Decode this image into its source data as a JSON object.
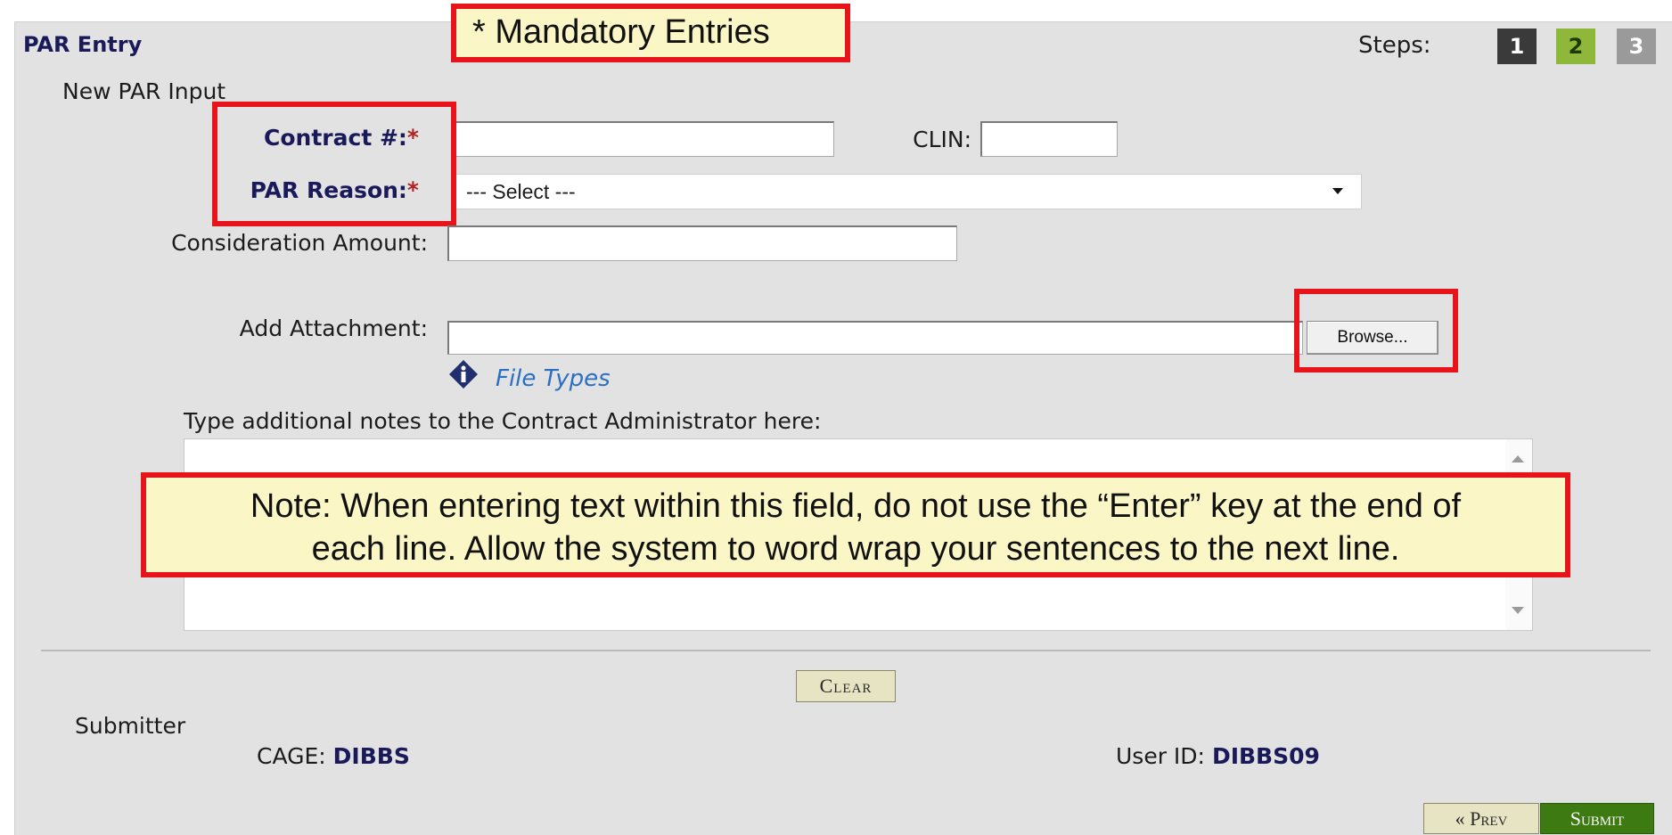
{
  "header": {
    "title": "PAR Entry",
    "steps_label": "Steps:",
    "steps": [
      {
        "label": "1",
        "color": "#3a3a3a",
        "text_color": "#ffffff"
      },
      {
        "label": "2",
        "color": "#8fb83a",
        "text_color": "#1a3a00"
      },
      {
        "label": "3",
        "color": "#9a9a9a",
        "text_color": "#ffffff"
      }
    ]
  },
  "callouts": {
    "mandatory": "* Mandatory Entries",
    "note_line1": "Note:  When entering text within this field, do not use the “Enter” key at the end of",
    "note_line2": "each line.  Allow the system to word wrap your sentences to the next line."
  },
  "form": {
    "section_title": "New PAR Input",
    "contract_label": "Contract #:",
    "required_mark": "*",
    "contract_value": "",
    "clin_label": "CLIN:",
    "clin_value": "",
    "par_reason_label": "PAR Reason:",
    "par_reason_selected": "--- Select ---",
    "consideration_label": "Consideration Amount:",
    "consideration_value": "",
    "attachment_label": "Add Attachment:",
    "attachment_value": "",
    "browse_label": "Browse...",
    "file_types_link": "File Types",
    "notes_label": "Type additional notes to the Contract Administrator here:",
    "notes_value": ""
  },
  "actions": {
    "clear_label": "Clear",
    "prev_label": "« Prev",
    "submit_label": "Submit"
  },
  "submitter": {
    "heading": "Submitter",
    "cage_label": "CAGE:",
    "cage_value": "DIBBS",
    "userid_label": "User ID:",
    "userid_value": "DIBBS09"
  },
  "colors": {
    "panel_bg": "#e2e2e2",
    "highlight_red": "#e8141b",
    "callout_bg": "#fbf6c6",
    "link_blue": "#2b6fc4",
    "submit_green": "#3d7a12"
  }
}
